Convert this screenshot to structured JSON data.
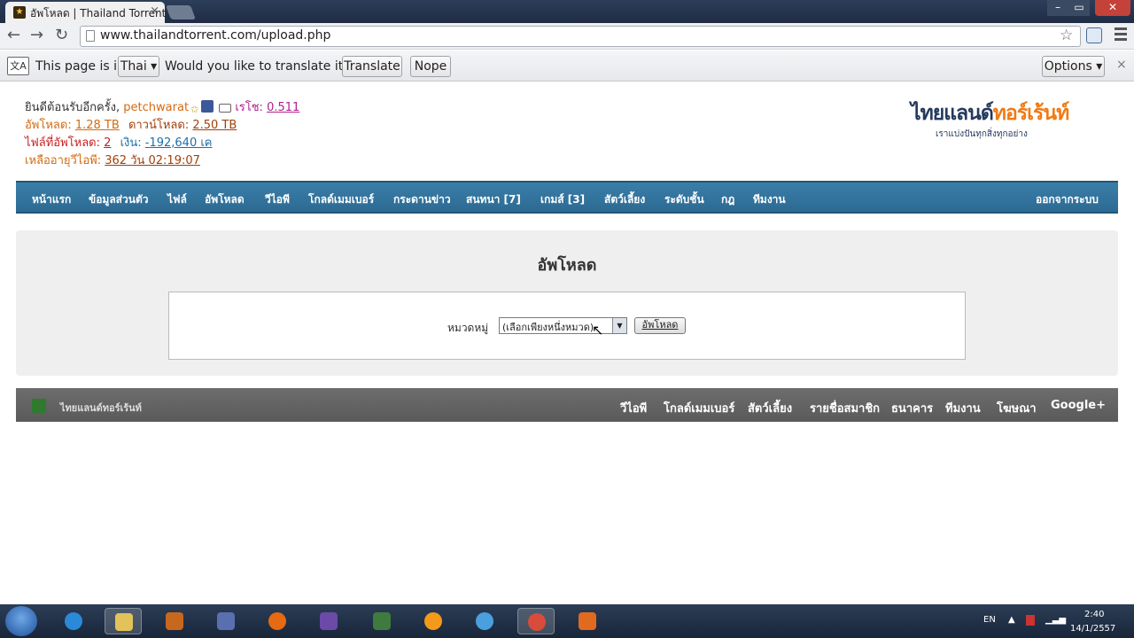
{
  "browser": {
    "tab_title": "อัพโหลด | Thailand Torrent",
    "tab_close": "×",
    "favicon": "tt-favicon-icon",
    "url": "www.thailandtorrent.com/upload.php",
    "window_min": "–",
    "window_max": "▭",
    "window_close": "✕"
  },
  "translate_bar": {
    "text1": "This page is in",
    "language": "Thai ▾",
    "question": "Would you like to translate it?",
    "translate_btn": "Translate",
    "nope_btn": "Nope",
    "options_btn": "Options ▾",
    "close": "×",
    "icon_text": "文A"
  },
  "user": {
    "welcome": "ยินดีต้อนรับอีกครั้ง,",
    "username": "petchwarat",
    "ratio_label": "เรโช:",
    "ratio_value": "0.511",
    "upload_label": "อัพโหลด:",
    "upload_value": "1.28 TB",
    "download_label": "ดาวน์โหลด:",
    "download_value": "2.50 TB",
    "files_label": "ไฟล์ที่อัพโหลด:",
    "files_value": "2",
    "money_label": "เงิน:",
    "money_value": "-192,640 เค",
    "vip_label": "เหลืออายุวีไอพี:",
    "vip_value": "362 วัน 02:19:07"
  },
  "logo": {
    "part1": "ไทยแลนด์",
    "part2": "ทอร์เร้นท์",
    "tagline": "เราแบ่งปันทุกสิ่งทุกอย่าง"
  },
  "nav": {
    "items": [
      "หน้าแรก",
      "ข้อมูลส่วนตัว",
      "ไฟล์",
      "อัพโหลด",
      "วีไอพี",
      "โกลด์เมมเบอร์",
      "กระดานข่าว",
      "สนทนา [7]",
      "เกมส์ [3]",
      "สัตว์เลี้ยง",
      "ระดับชั้น",
      "กฎ",
      "ทีมงาน"
    ],
    "logout": "ออกจากระบบ"
  },
  "upload": {
    "title": "อัพโหลด",
    "category_label": "หมวดหมู่",
    "select_value": "(เลือกเพียงหนึ่งหมวด)",
    "submit": "อัพโหลด"
  },
  "footer": {
    "left_text": "ไทยแลนด์ทอร์เร้นท์",
    "items": [
      "วีไอพี",
      "โกลด์เมมเบอร์",
      "สัตว์เลี้ยง",
      "รายชื่อสมาชิก",
      "ธนาคาร",
      "ทีมงาน",
      "โฆษณา",
      "Google+"
    ]
  },
  "taskbar": {
    "lang": "EN",
    "time": "2:40",
    "date": "14/1/2557"
  }
}
